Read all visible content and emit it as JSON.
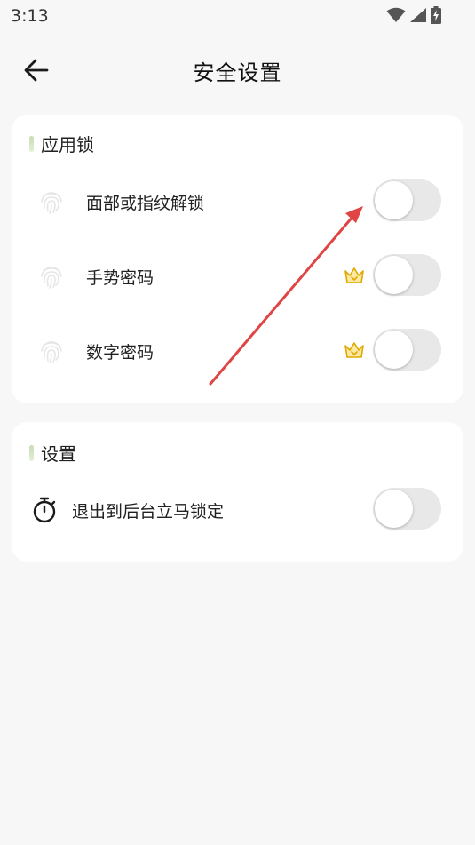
{
  "status_bar": {
    "time": "3:13",
    "icons": [
      "wifi-icon",
      "signal-icon",
      "battery-charging-icon"
    ]
  },
  "header": {
    "title": "安全设置",
    "back_icon": "arrow-left-icon"
  },
  "app_lock_section": {
    "title": "应用锁",
    "items": [
      {
        "label": "面部或指纹解锁",
        "icon": "fingerprint-icon",
        "premium": false,
        "enabled": false
      },
      {
        "label": "手势密码",
        "icon": "fingerprint-icon",
        "premium": true,
        "enabled": false
      },
      {
        "label": "数字密码",
        "icon": "fingerprint-icon",
        "premium": true,
        "enabled": false
      }
    ]
  },
  "settings_section": {
    "title": "设置",
    "items": [
      {
        "label": "退出到后台立马锁定",
        "icon": "stopwatch-icon",
        "enabled": false
      }
    ]
  },
  "colors": {
    "background": "#f7f7f7",
    "card": "#ffffff",
    "toggle_off": "#e8e8e8",
    "accent_bar": "#c8dcb4",
    "crown": "#f2c230",
    "annotation_arrow": "#e04444"
  }
}
